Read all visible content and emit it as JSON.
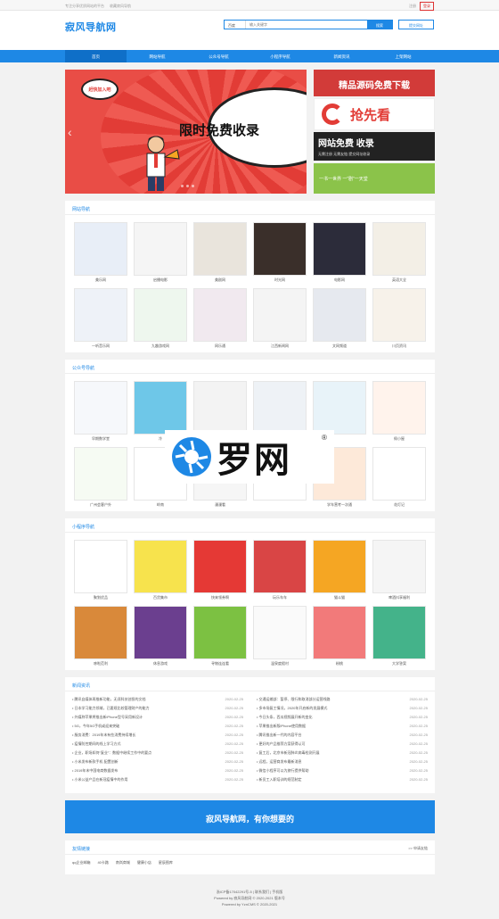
{
  "topbar": {
    "left": [
      "专注分享优质网站的平台",
      "收藏寂风导航"
    ],
    "login": "注册",
    "register": "登录"
  },
  "header": {
    "logo": "寂风导航网",
    "search_select": "百度",
    "search_placeholder": "输入关键字",
    "search_button": "搜索",
    "submit_button": "提交网址"
  },
  "nav": [
    "首页",
    "网站导航",
    "公众号导航",
    "小程序导航",
    "新闻资讯",
    "上架网站"
  ],
  "banner": {
    "small_bubble": "赶快加入吧",
    "cloud_text": "限时免费收录",
    "prev": "‹",
    "next": "›"
  },
  "side_ads": {
    "ad1": "精品源码免费下载",
    "ad2": "抢先看",
    "ad3_title": "网站免费 收录",
    "ad3_sub": "无需注册 无需友链      提交网址收录",
    "ad4": "一书一世界  一“剧”一天堂"
  },
  "sections": {
    "websites": {
      "title": "网站导航",
      "items": [
        "美乐网",
        "启播电影",
        "美剧网",
        "时光网",
        "电影网",
        "英语大全",
        "一听音乐网",
        "九趣游戏网",
        "网乐通",
        "江西新闻网",
        "文网频道",
        "川页资讯"
      ]
    },
    "official": {
      "title": "公众号导航",
      "items": [
        "早期数学堂",
        "冷",
        "卖菜侠",
        "",
        "",
        "佩小屋",
        "广州会客户外",
        "岭南",
        "漫漫看",
        "",
        "学车营考一次通",
        "花灯记"
      ]
    },
    "miniapp": {
      "title": "小程序导航",
      "items": [
        "聚划优品",
        "百货集市",
        "快来领券啊",
        "玩乐车车",
        "猫斗猫",
        "啤酒抖享福利",
        "哆啦范利",
        "休息游戏",
        "寻物连连看",
        "温泉度假村",
        "粉桃",
        "大学答案"
      ]
    },
    "news": {
      "title": "新闻资讯",
      "left": [
        [
          "腾讯自媒体再推新功能，无须科技创投的文档",
          "2020-02-25"
        ],
        [
          "日本学习能力领域，已要规比较管理财产的能力",
          "2020-02-25"
        ],
        [
          "外媒称苹果将推出新iPhone型号采用新设计",
          "2020-02-25"
        ],
        [
          "5G，今年5G手机或迎来突破",
          "2020-02-25"
        ],
        [
          "服务消费：2019年末有些消费持续增长",
          "2020-02-25"
        ],
        [
          "疫情防控期间的线上学习方式",
          "2020-02-25"
        ],
        [
          "企业，职场如何“复业”：数据中继续工作中的要点",
          "2020-02-25"
        ],
        [
          "小米发布新款手机 配置创新",
          "2020-02-25"
        ],
        [
          "2019年末中国电商数据发布",
          "2020-02-25"
        ],
        [
          "小米公益产品在新冠疫情中的作用",
          "2020-02-25"
        ]
      ],
      "right": [
        [
          "交通运输部：暂停、限行和取消部分运营线路",
          "2020-02-25"
        ],
        [
          "多市场复工情况，2020年开启新的发展模式",
          "2020-02-25"
        ],
        [
          "今日头条，西瓜视频展开新的变化",
          "2020-02-25"
        ],
        [
          "苹果推出新版iPhone使用数据",
          "2020-02-25"
        ],
        [
          "腾讯推出新一代的内容平台",
          "2020-02-25"
        ],
        [
          "更好的产品推荐方案获得认可",
          "2020-02-25"
        ],
        [
          "复工后，北京市新冠肺炎病毒检测开展",
          "2020-02-25"
        ],
        [
          "远程，运营商发布最新消息",
          "2020-02-25"
        ],
        [
          "微信小程序可以为旅行提供帮助",
          "2020-02-25"
        ],
        [
          "新员工入职培训的规范制定",
          "2020-02-25"
        ]
      ]
    }
  },
  "cta": "寂风导航网，有你想要的",
  "links": {
    "title": "友情链接",
    "more": ">> 申请友链",
    "items": [
      "qq企业邮箱",
      "40卡路",
      "南岚商城",
      "健康小店",
      "星辰图库"
    ]
  },
  "footer": [
    "浙ICP备17042291号-5 | 联系我们 | 手机版",
    "Powered by 寂风导航网 © 2020-2021 版本号",
    "Powered by YznCMS © 2020-2021"
  ],
  "watermark": "罗网",
  "colors": {
    "primary": "#1e88e5",
    "banner_red": "#e94d46",
    "ad_red": "#d23b39",
    "ad_green": "#8bc34a"
  }
}
